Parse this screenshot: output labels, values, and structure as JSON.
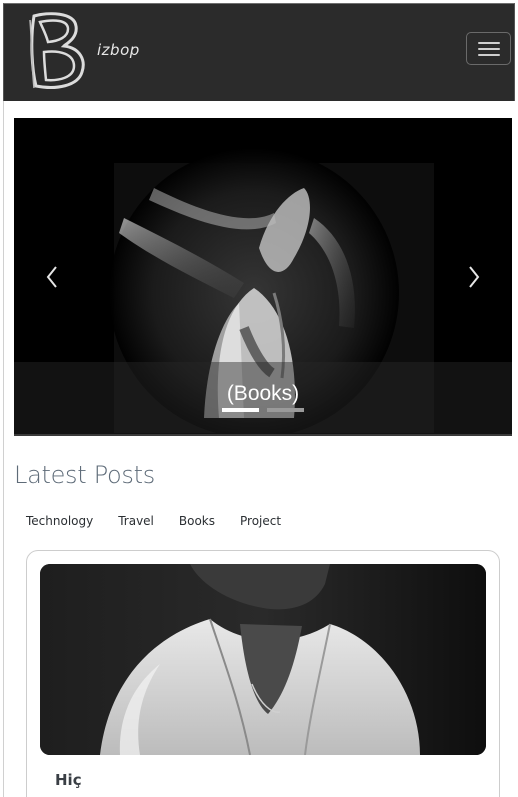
{
  "brand": {
    "logo_letter": "B",
    "text": "izbop"
  },
  "nav": {
    "toggler_icon": "hamburger-icon"
  },
  "carousel": {
    "caption": "(Books)",
    "slide_count": 2,
    "active_slide": 1,
    "prev_icon": "chevron-left-icon",
    "next_icon": "chevron-right-icon"
  },
  "latest": {
    "title": "Latest Posts",
    "filters": [
      "Technology",
      "Travel",
      "Books",
      "Project"
    ]
  },
  "post": {
    "title": "Hiç"
  },
  "colors": {
    "navbar": "#2b2b2b",
    "heading": "#5e6b78",
    "text": "#2b2f33"
  }
}
